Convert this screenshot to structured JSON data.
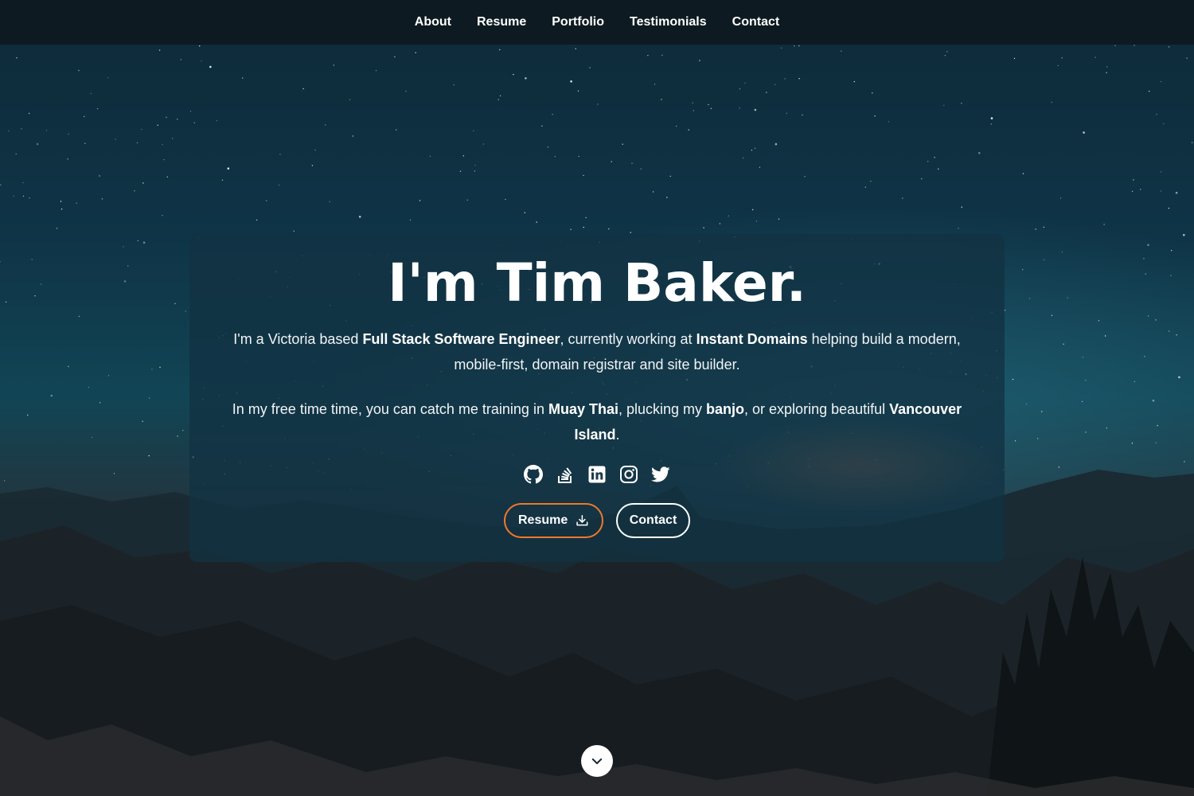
{
  "nav": {
    "items": [
      {
        "label": "About"
      },
      {
        "label": "Resume"
      },
      {
        "label": "Portfolio"
      },
      {
        "label": "Testimonials"
      },
      {
        "label": "Contact"
      }
    ]
  },
  "hero": {
    "title": "I'm Tim Baker.",
    "intro": {
      "t1": "I'm a Victoria based ",
      "b1": "Full Stack Software Engineer",
      "t2": ", currently working at ",
      "b2": "Instant Domains",
      "t3": " helping build a modern, mobile-first, domain registrar and site builder."
    },
    "hobbies": {
      "t1": "In my free time time, you can catch me training in ",
      "b1": "Muay Thai",
      "t2": ", plucking my ",
      "b2": "banjo",
      "t3": ", or exploring beautiful ",
      "b3": "Vancouver Island",
      "t4": "."
    },
    "socials": [
      {
        "icon": "github-icon"
      },
      {
        "icon": "stackoverflow-icon"
      },
      {
        "icon": "linkedin-icon"
      },
      {
        "icon": "instagram-icon"
      },
      {
        "icon": "twitter-icon"
      }
    ],
    "buttons": {
      "resume_label": "Resume",
      "resume_icon": "download-icon",
      "contact_label": "Contact"
    },
    "scroll_icon": "chevron-down-icon"
  },
  "colors": {
    "accent": "#f0782c",
    "nav_bg": "#0e181e",
    "card_bg": "#123242"
  }
}
